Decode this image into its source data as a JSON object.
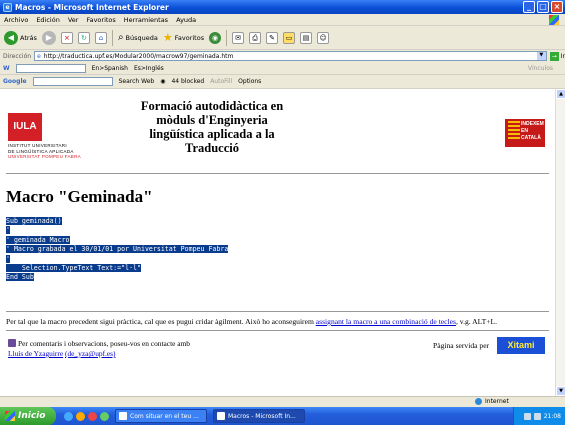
{
  "window": {
    "title": "Macros - Microsoft Internet Explorer"
  },
  "menu": [
    "Archivo",
    "Edición",
    "Ver",
    "Favoritos",
    "Herramientas",
    "Ayuda"
  ],
  "toolbar": {
    "back": "Atrás",
    "search": "Búsqueda",
    "favorites": "Favoritos"
  },
  "address": {
    "label": "Dirección",
    "url": "http://traductica.upf.es/Modular2000/macrow97/geminada.htm",
    "go": "Ir",
    "links": "Vínculos"
  },
  "translate_bar": {
    "en_es": "En>Spanish",
    "es_en": "Es>Inglés"
  },
  "google_bar": {
    "google": "Google",
    "search_web": "Search Web",
    "blocked": "44 blocked",
    "autofill": "AutoFill",
    "options": "Options"
  },
  "page": {
    "iula_mark": "IULA",
    "iula_line1": "INSTITUT UNIVERSITARI",
    "iula_line2": "DE LINGÜÍSTICA APLICADA",
    "iula_line3": "UNIVERSITAT POMPEU FABRA",
    "heading": "Formació autodidàctica en mòduls d'Enginyeria lingüística aplicada a la Traducció",
    "indexem_1": "INDEXEM",
    "indexem_2": "EN",
    "indexem_3": "CATALÀ",
    "title": "Macro \"Geminada\"",
    "code": [
      "Sub geminada()",
      "'",
      "' geminada Macro",
      "' Macro grabada el 30/01/01 por Universitat Pompeu Fabra",
      "'",
      "    Selection.TypeText Text:=\"l·l\"",
      "End Sub"
    ],
    "para_before": "Per tal que la macro precedent sigui pràctica, cal que es pugui cridar àgilment. Això ho aconseguirem ",
    "para_link": "assignant la macro a una combinació de tecles",
    "para_after": ", v.g. ALT+L.",
    "footer_text1": "Per comentaris i observacions, poseu-vos en contacte amb ",
    "footer_link1": "Lluís de Yzaguirre",
    "footer_link2": "(de_yza@upf.es)",
    "served_by": "Pàgina servida per",
    "xitami": "Xitami"
  },
  "status": {
    "zone": "Internet"
  },
  "taskbar": {
    "start": "Inicio",
    "task1": "Com situar en el teu ...",
    "task2": "Macros - Microsoft In...",
    "clock": "21:08"
  }
}
